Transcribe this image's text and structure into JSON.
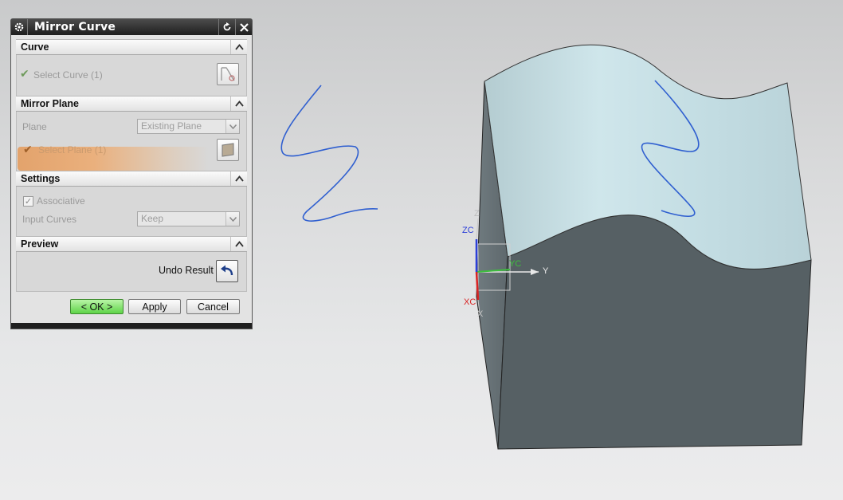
{
  "dialog": {
    "title": "Mirror Curve",
    "sections": {
      "curve": {
        "header": "Curve",
        "select_label": "Select Curve (1)"
      },
      "mirror_plane": {
        "header": "Mirror Plane",
        "plane_label": "Plane",
        "plane_value": "Existing Plane",
        "select_label": "Select Plane (1)"
      },
      "settings": {
        "header": "Settings",
        "associative_label": "Associative",
        "associative_checked": true,
        "input_curves_label": "Input Curves",
        "input_curves_value": "Keep"
      },
      "preview": {
        "header": "Preview",
        "undo_label": "Undo Result"
      }
    },
    "buttons": {
      "ok": "< OK >",
      "apply": "Apply",
      "cancel": "Cancel"
    }
  },
  "viewport": {
    "axes": {
      "z": "Z",
      "zc": "ZC",
      "yc": "YC",
      "y": "Y",
      "xc": "XC",
      "x": "X"
    },
    "colors": {
      "solid_top": "#c8e1e6",
      "solid_side": "#566064",
      "solid_left": "#6a7579",
      "curve": "#2f5fd0",
      "x_axis": "#d92424",
      "y_axis": "#1fa51f",
      "z_axis": "#2b3fd8"
    }
  }
}
